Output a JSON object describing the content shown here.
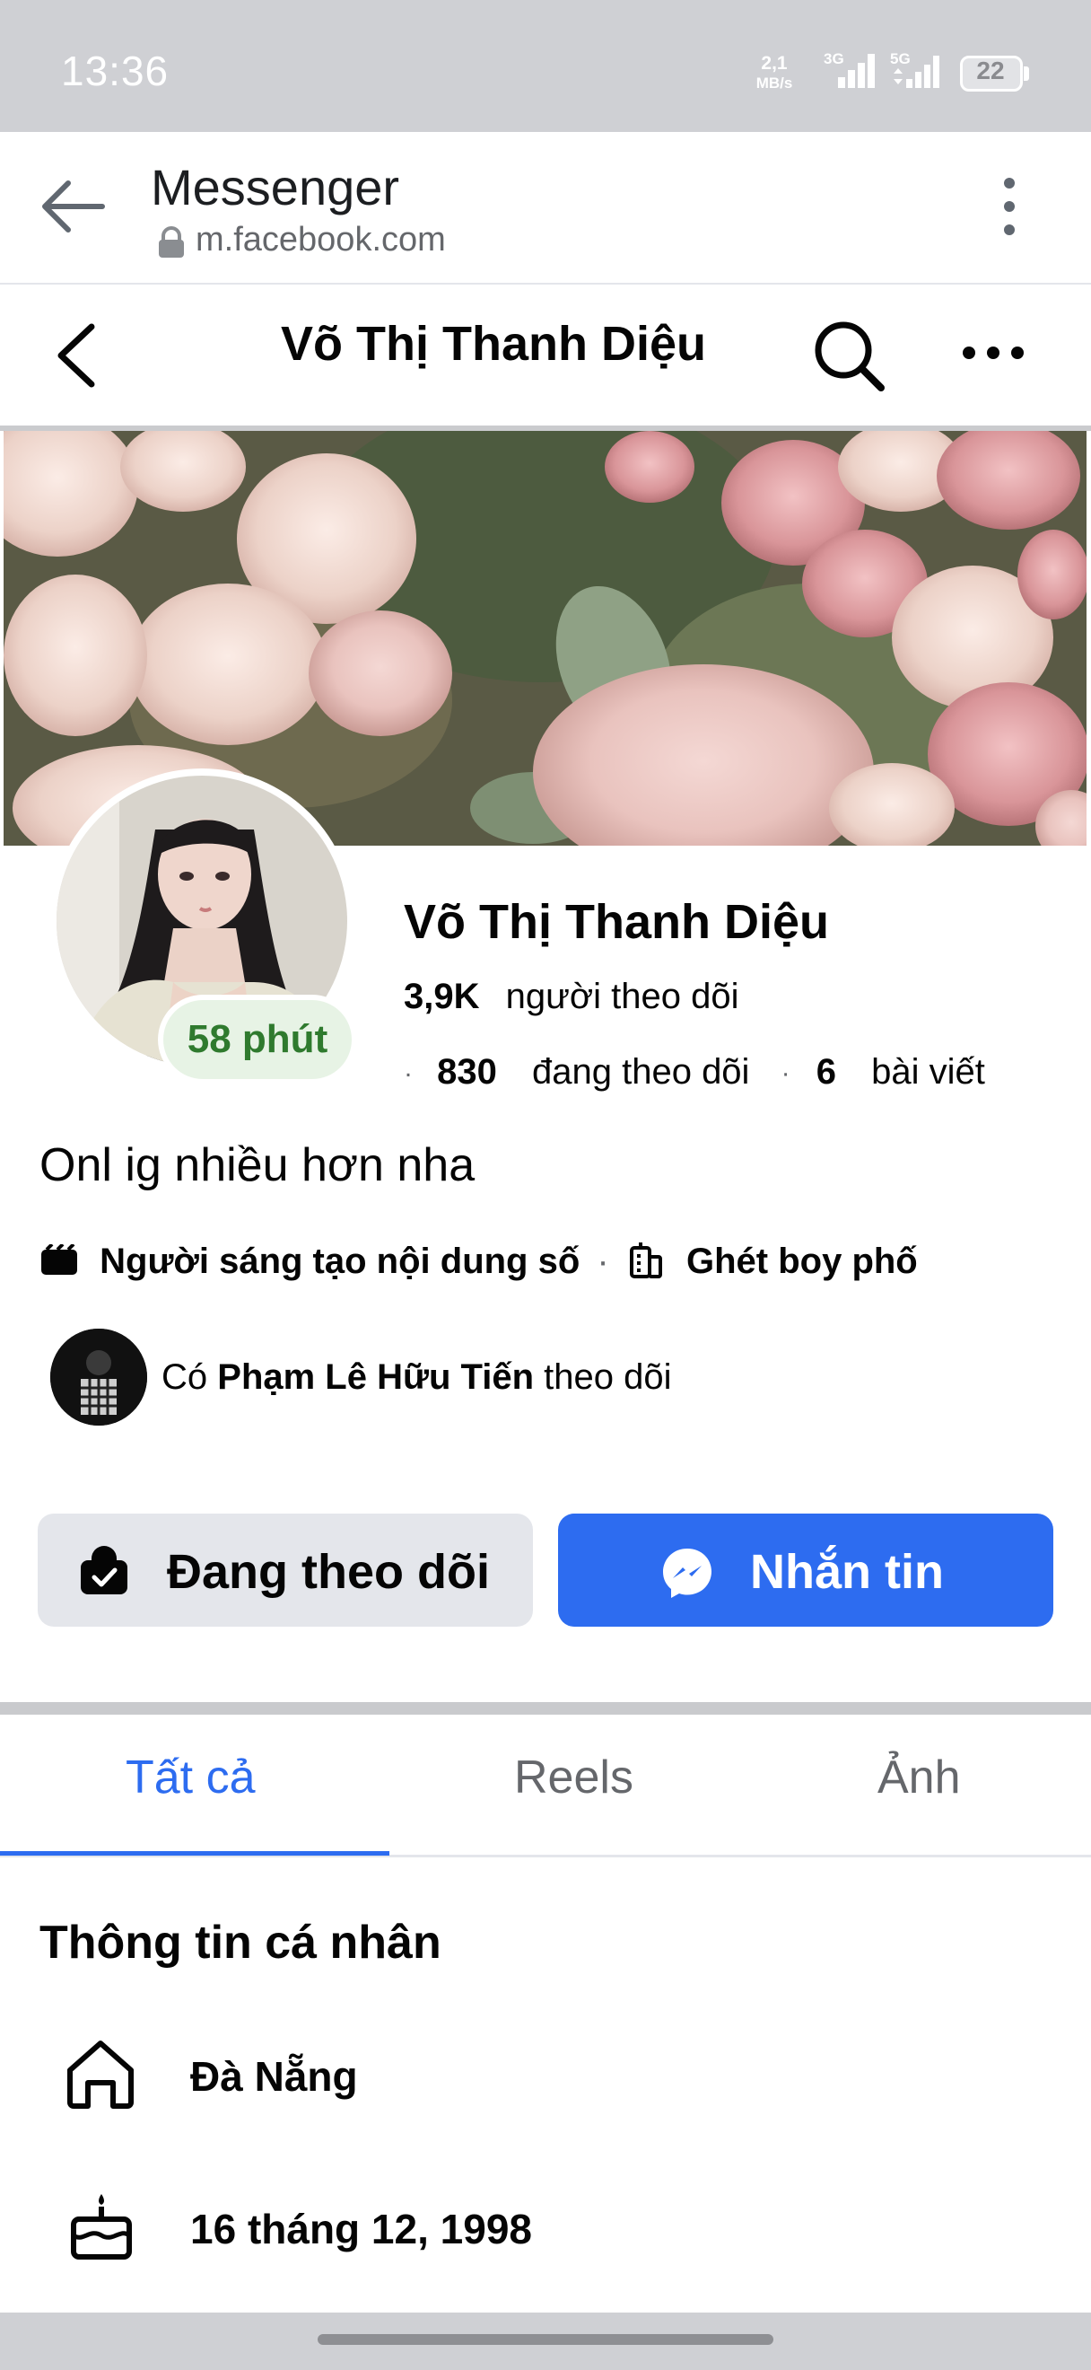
{
  "status_bar": {
    "time": "13:36",
    "net_speed_value": "2,1",
    "net_speed_unit": "MB/s",
    "sig1": "3G",
    "sig2": "5G",
    "battery": "22"
  },
  "browser": {
    "title": "Messenger",
    "url": "m.facebook.com"
  },
  "header": {
    "title": "Võ Thị Thanh Diệu"
  },
  "profile": {
    "name": "Võ Thị Thanh Diệu",
    "online_badge": "58 phút",
    "followers_count": "3,9K",
    "followers_label": "người theo dõi",
    "following_count": "830",
    "following_label": "đang theo dõi",
    "posts_count": "6",
    "posts_label": "bài viết",
    "bio": "Onl ig nhiều hơn nha",
    "tag1": "Người sáng tạo nội dung số",
    "tag2": "Ghét boy phố",
    "mutual_prefix": "Có",
    "mutual_name": "Phạm Lê Hữu Tiến",
    "mutual_suffix": "theo dõi"
  },
  "actions": {
    "following_label": "Đang theo dõi",
    "message_label": "Nhắn tin"
  },
  "tabs": [
    {
      "label": "Tất cả",
      "active": true
    },
    {
      "label": "Reels",
      "active": false
    },
    {
      "label": "Ảnh",
      "active": false
    }
  ],
  "info": {
    "title": "Thông tin cá nhân",
    "location": "Đà Nẵng",
    "birthday": "16 tháng 12, 1998"
  },
  "colors": {
    "accent": "#2d6cf0",
    "online": "#2f7a2e"
  },
  "icons": [
    "back-arrow-icon",
    "lock-icon",
    "more-vertical-icon",
    "chevron-left-icon",
    "search-icon",
    "more-horizontal-icon",
    "clapperboard-icon",
    "building-icon",
    "person-check-icon",
    "messenger-icon",
    "home-icon",
    "cake-icon"
  ]
}
